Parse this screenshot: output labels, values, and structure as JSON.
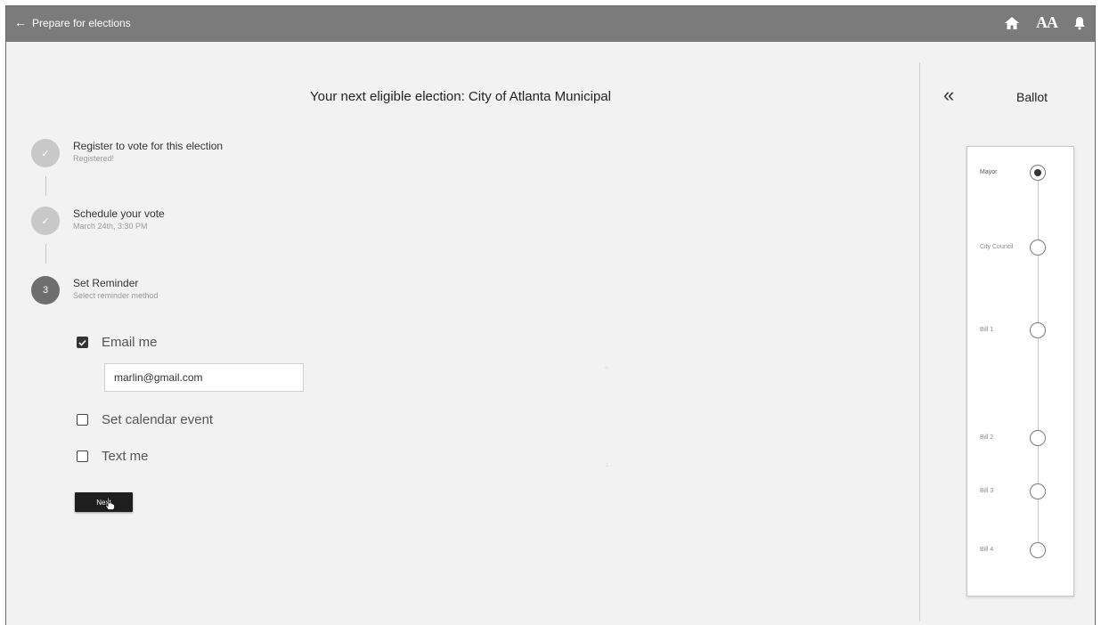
{
  "header": {
    "back_glyph": "←",
    "title": "Prepare for elections",
    "icons": [
      "home-icon",
      "text-size-icon",
      "notification-bell-icon"
    ],
    "text_size_glyph": "AA"
  },
  "main": {
    "title": "Your next eligible election: City of Atlanta Municipal",
    "steps": [
      {
        "title": "Register to vote for this election",
        "subtitle": "Registered!",
        "status": "complete",
        "marker": "✓"
      },
      {
        "title": "Schedule your vote",
        "subtitle": "March 24th, 3:30 PM",
        "status": "complete",
        "marker": "✓"
      },
      {
        "title": "Set Reminder",
        "subtitle": "Select reminder method",
        "status": "active",
        "marker": "3"
      }
    ],
    "reminder_options": [
      {
        "label": "Email me",
        "checked": true
      },
      {
        "label": "Set calendar event",
        "checked": false
      },
      {
        "label": "Text me",
        "checked": false
      }
    ],
    "email_value": "marlin@gmail.com",
    "next_button": "Next",
    "faint_marks": [
      "4",
      "1"
    ]
  },
  "ballot": {
    "collapse_glyph": "«",
    "title": "Ballot",
    "items": [
      {
        "label": "Mayor",
        "current": true
      },
      {
        "label": "City Council",
        "current": false
      },
      {
        "label": "Bill 1",
        "current": false
      },
      {
        "label": "Bill 2",
        "current": false
      },
      {
        "label": "Bill 3",
        "current": false
      },
      {
        "label": "Bill 4",
        "current": false
      }
    ]
  },
  "colors": {
    "header_bg": "#7b7b7b",
    "page_bg": "#f2f2f2",
    "step_complete": "#c8c8c8",
    "step_active": "#6e6e6e",
    "button_bg": "#1e1e1e"
  }
}
